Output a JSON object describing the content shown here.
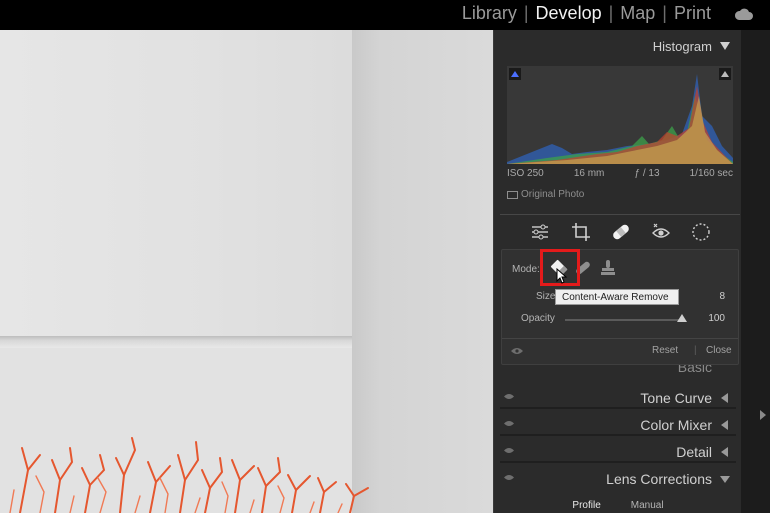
{
  "modules": {
    "items": [
      "Library",
      "Develop",
      "Map",
      "Print"
    ],
    "active": "Develop",
    "cloud_icon": "cloud-icon"
  },
  "histogram": {
    "title": "Histogram",
    "iso": "ISO 250",
    "focal": "16 mm",
    "aperture": "ƒ / 13",
    "shutter": "1/160 sec",
    "original_photo": "Original Photo"
  },
  "toolstrip": {
    "icons": [
      "edit-sliders-icon",
      "crop-icon",
      "healing-icon",
      "red-eye-icon",
      "masking-icon"
    ],
    "active": "healing-icon"
  },
  "heal": {
    "mode_label": "Mode:",
    "modes": [
      "content-aware-remove-icon",
      "heal-icon",
      "clone-icon"
    ],
    "size_label": "Size",
    "size_value": "8",
    "opacity_label": "Opacity",
    "opacity_value": "100",
    "opacity_fraction": 1.0,
    "reset_label": "Reset",
    "close_label": "Close"
  },
  "tooltip": {
    "text": "Content-Aware Remove"
  },
  "sections": {
    "basic": "Basic",
    "tone_curve": "Tone Curve",
    "color_mixer": "Color Mixer",
    "detail": "Detail",
    "lens_corrections": "Lens Corrections"
  },
  "lens_tabs": {
    "profile": "Profile",
    "manual": "Manual"
  },
  "colors": {
    "highlight": "#e41b1b",
    "panel": "#2b2b2b",
    "accent_blue": "#4b6fff"
  }
}
